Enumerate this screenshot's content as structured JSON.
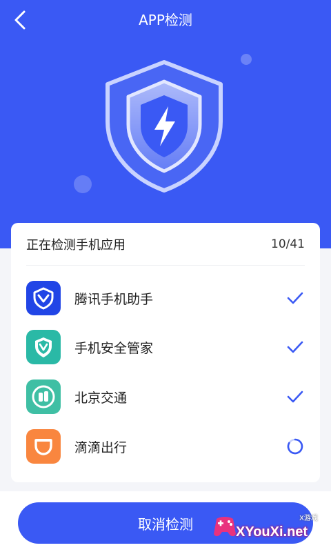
{
  "header": {
    "title": "APP检测"
  },
  "scan": {
    "heading": "正在检测手机应用",
    "progress": "10/41",
    "apps": [
      {
        "name": "腾讯手机助手",
        "status": "done",
        "icon": "tencent-shield-icon",
        "color": "#2145e6"
      },
      {
        "name": "手机安全管家",
        "status": "done",
        "icon": "security-shield-icon",
        "color": "#2ab9a6"
      },
      {
        "name": "北京交通",
        "status": "done",
        "icon": "bus-icon",
        "color": "#3fbfa4"
      },
      {
        "name": "滴滴出行",
        "status": "scanning",
        "icon": "didi-icon",
        "color": "#f9863f"
      }
    ]
  },
  "footer": {
    "cancel_label": "取消检测"
  },
  "watermark": {
    "main": "XYouXi.net",
    "sub": "X游戏"
  },
  "colors": {
    "accent": "#3a59f4",
    "check": "#3a59f4"
  }
}
